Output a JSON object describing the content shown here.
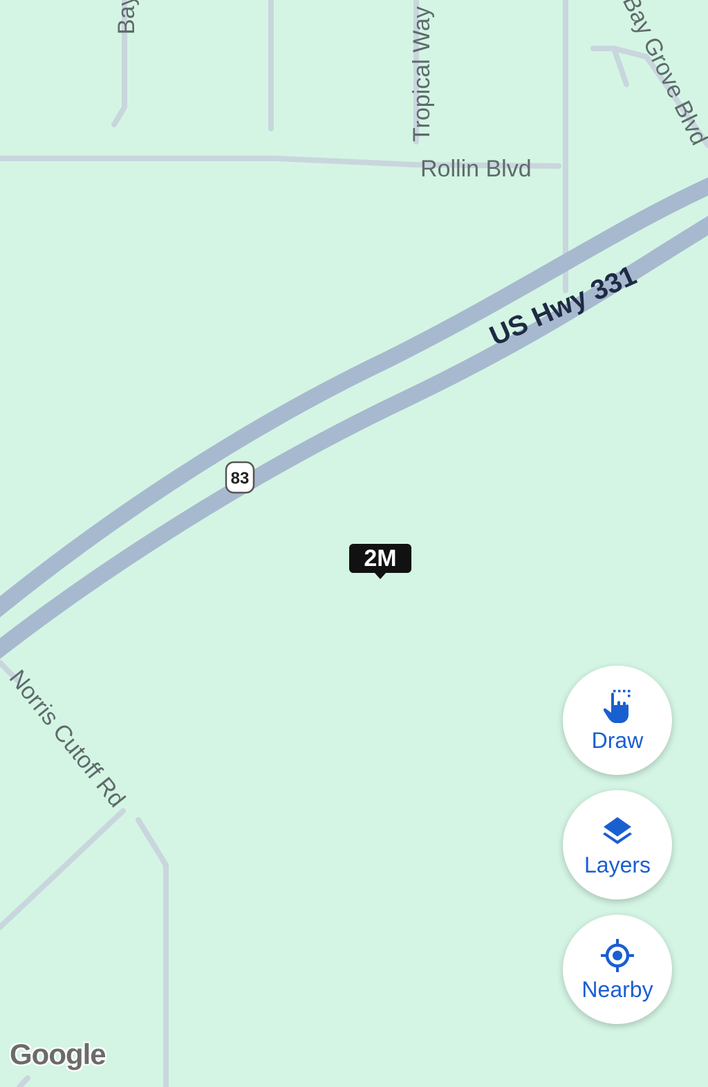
{
  "map": {
    "roads": {
      "bay_partial": "Bay",
      "tropical_way": "Tropical Way",
      "bay_grove_blvd": "Bay Grove Blvd",
      "rollin_blvd": "Rollin Blvd",
      "us_hwy_331": "US Hwy 331",
      "norris_cutoff_rd": "Norris Cutoff Rd"
    },
    "route_shield": "83",
    "listing_marker": "2M",
    "attribution": "Google"
  },
  "controls": {
    "draw_label": "Draw",
    "layers_label": "Layers",
    "nearby_label": "Nearby"
  },
  "colors": {
    "land": "#d4f5e4",
    "minor_road": "#c9d6dd",
    "highway": "#a7b9cf",
    "accent": "#1a5fd0"
  },
  "icons": {
    "draw": "pointing-hand-icon",
    "layers": "layers-icon",
    "nearby": "location-target-icon"
  }
}
